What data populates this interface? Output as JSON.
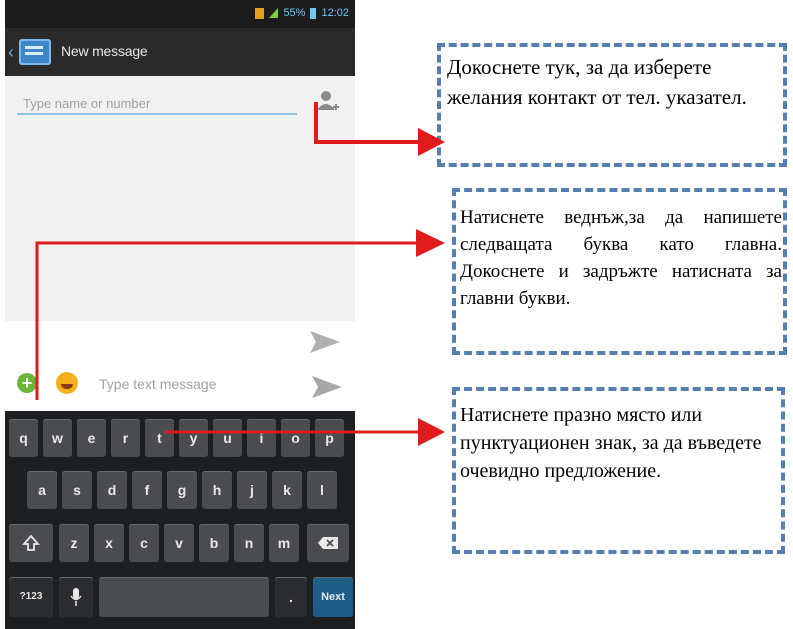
{
  "statusbar": {
    "battery": "55%",
    "time": "12:02"
  },
  "actionbar": {
    "title": "New message"
  },
  "compose": {
    "recipient_placeholder": "Type name or number",
    "message_placeholder": "Type text message"
  },
  "keyboard": {
    "row1": [
      "q",
      "w",
      "e",
      "r",
      "t",
      "y",
      "u",
      "i",
      "o",
      "p"
    ],
    "row2": [
      "a",
      "s",
      "d",
      "f",
      "g",
      "h",
      "j",
      "k",
      "l"
    ],
    "row3": [
      "z",
      "x",
      "c",
      "v",
      "b",
      "n",
      "m"
    ],
    "symbols_key": "?123",
    "next_key": "Next",
    "period_key": "."
  },
  "callouts": {
    "contact": "Докоснете тук, за да изберете желания контакт от тел. указател.",
    "shift": "Натиснете веднъж,за да напишете следващата буква като главна. Докоснете и задръжте натисната за главни букви.",
    "space": "Натиснете празно място или пунктуационен знак, за да въведете очевидно предложение."
  },
  "colors": {
    "arrow": "#e01b1b",
    "callout_border": "#557eb1",
    "actionbar": "#2a2a2a",
    "keyboard": "#1e1f22"
  }
}
